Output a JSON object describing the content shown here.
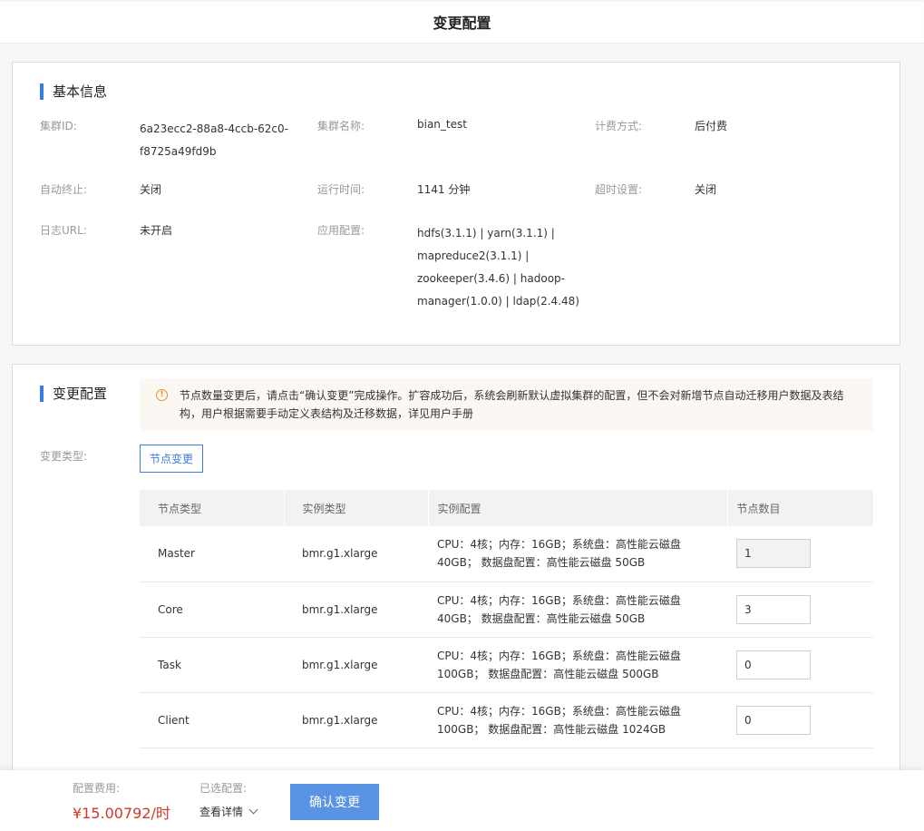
{
  "header": {
    "title": "变更配置"
  },
  "basic": {
    "title": "基本信息",
    "cluster_id_label": "集群ID:",
    "cluster_id_line1": "6a23ecc2-88a8-4ccb-62c0-",
    "cluster_id_line2": "f8725a49fd9b",
    "cluster_name_label": "集群名称:",
    "cluster_name": "bian_test",
    "billing_label": "计费方式:",
    "billing": "后付费",
    "auto_stop_label": "自动终止:",
    "auto_stop": "关闭",
    "runtime_label": "运行时间:",
    "runtime": "1141 分钟",
    "timeout_label": "超时设置:",
    "timeout": "关闭",
    "log_url_label": "日志URL:",
    "log_url": "未开启",
    "app_config_label": "应用配置:",
    "app_config_lines": [
      "hdfs(3.1.1) | yarn(3.1.1) |",
      "mapreduce2(3.1.1) |",
      "zookeeper(3.4.6) | hadoop-",
      "manager(1.0.0) | ldap(2.4.48)"
    ]
  },
  "change": {
    "title": "变更配置",
    "notice_icon": "warning-icon",
    "notice": "节点数量变更后，请点击“确认变更”完成操作。扩容成功后，系统会刷新默认虚拟集群的配置，但不会对新增节点自动迁移用户数据及表结构，用户根据需要手动定义表结构及迁移数据，详见用户手册",
    "change_type_label": "变更类型:",
    "change_type_button": "节点变更",
    "table": {
      "headers": [
        "节点类型",
        "实例类型",
        "实例配置",
        "节点数目"
      ],
      "rows": [
        {
          "node_type": "Master",
          "instance_type": "bmr.g1.xlarge",
          "config_line1": "CPU：4核；内存：16GB；系统盘：高性能云磁盘",
          "config_line2": "40GB； 数据盘配置：高性能云磁盘 50GB",
          "count": "1",
          "editable": false
        },
        {
          "node_type": "Core",
          "instance_type": "bmr.g1.xlarge",
          "config_line1": "CPU：4核；内存：16GB；系统盘：高性能云磁盘",
          "config_line2": "40GB； 数据盘配置：高性能云磁盘 50GB",
          "count": "3",
          "editable": true
        },
        {
          "node_type": "Task",
          "instance_type": "bmr.g1.xlarge",
          "config_line1": "CPU：4核；内存：16GB；系统盘：高性能云磁盘",
          "config_line2": "100GB； 数据盘配置：高性能云磁盘 500GB",
          "count": "0",
          "editable": true
        },
        {
          "node_type": "Client",
          "instance_type": "bmr.g1.xlarge",
          "config_line1": "CPU：4核；内存：16GB；系统盘：高性能云磁盘",
          "config_line2": "100GB； 数据盘配置：高性能云磁盘 1024GB",
          "count": "0",
          "editable": true
        }
      ]
    }
  },
  "footer": {
    "fee_label": "配置费用:",
    "fee_value": "¥15.00792/时",
    "selected_label": "已选配置:",
    "detail_link": "查看详情",
    "confirm_button": "确认变更"
  },
  "colors": {
    "accent": "#3b7dde",
    "price": "#d0392b",
    "warning": "#e8902a"
  }
}
